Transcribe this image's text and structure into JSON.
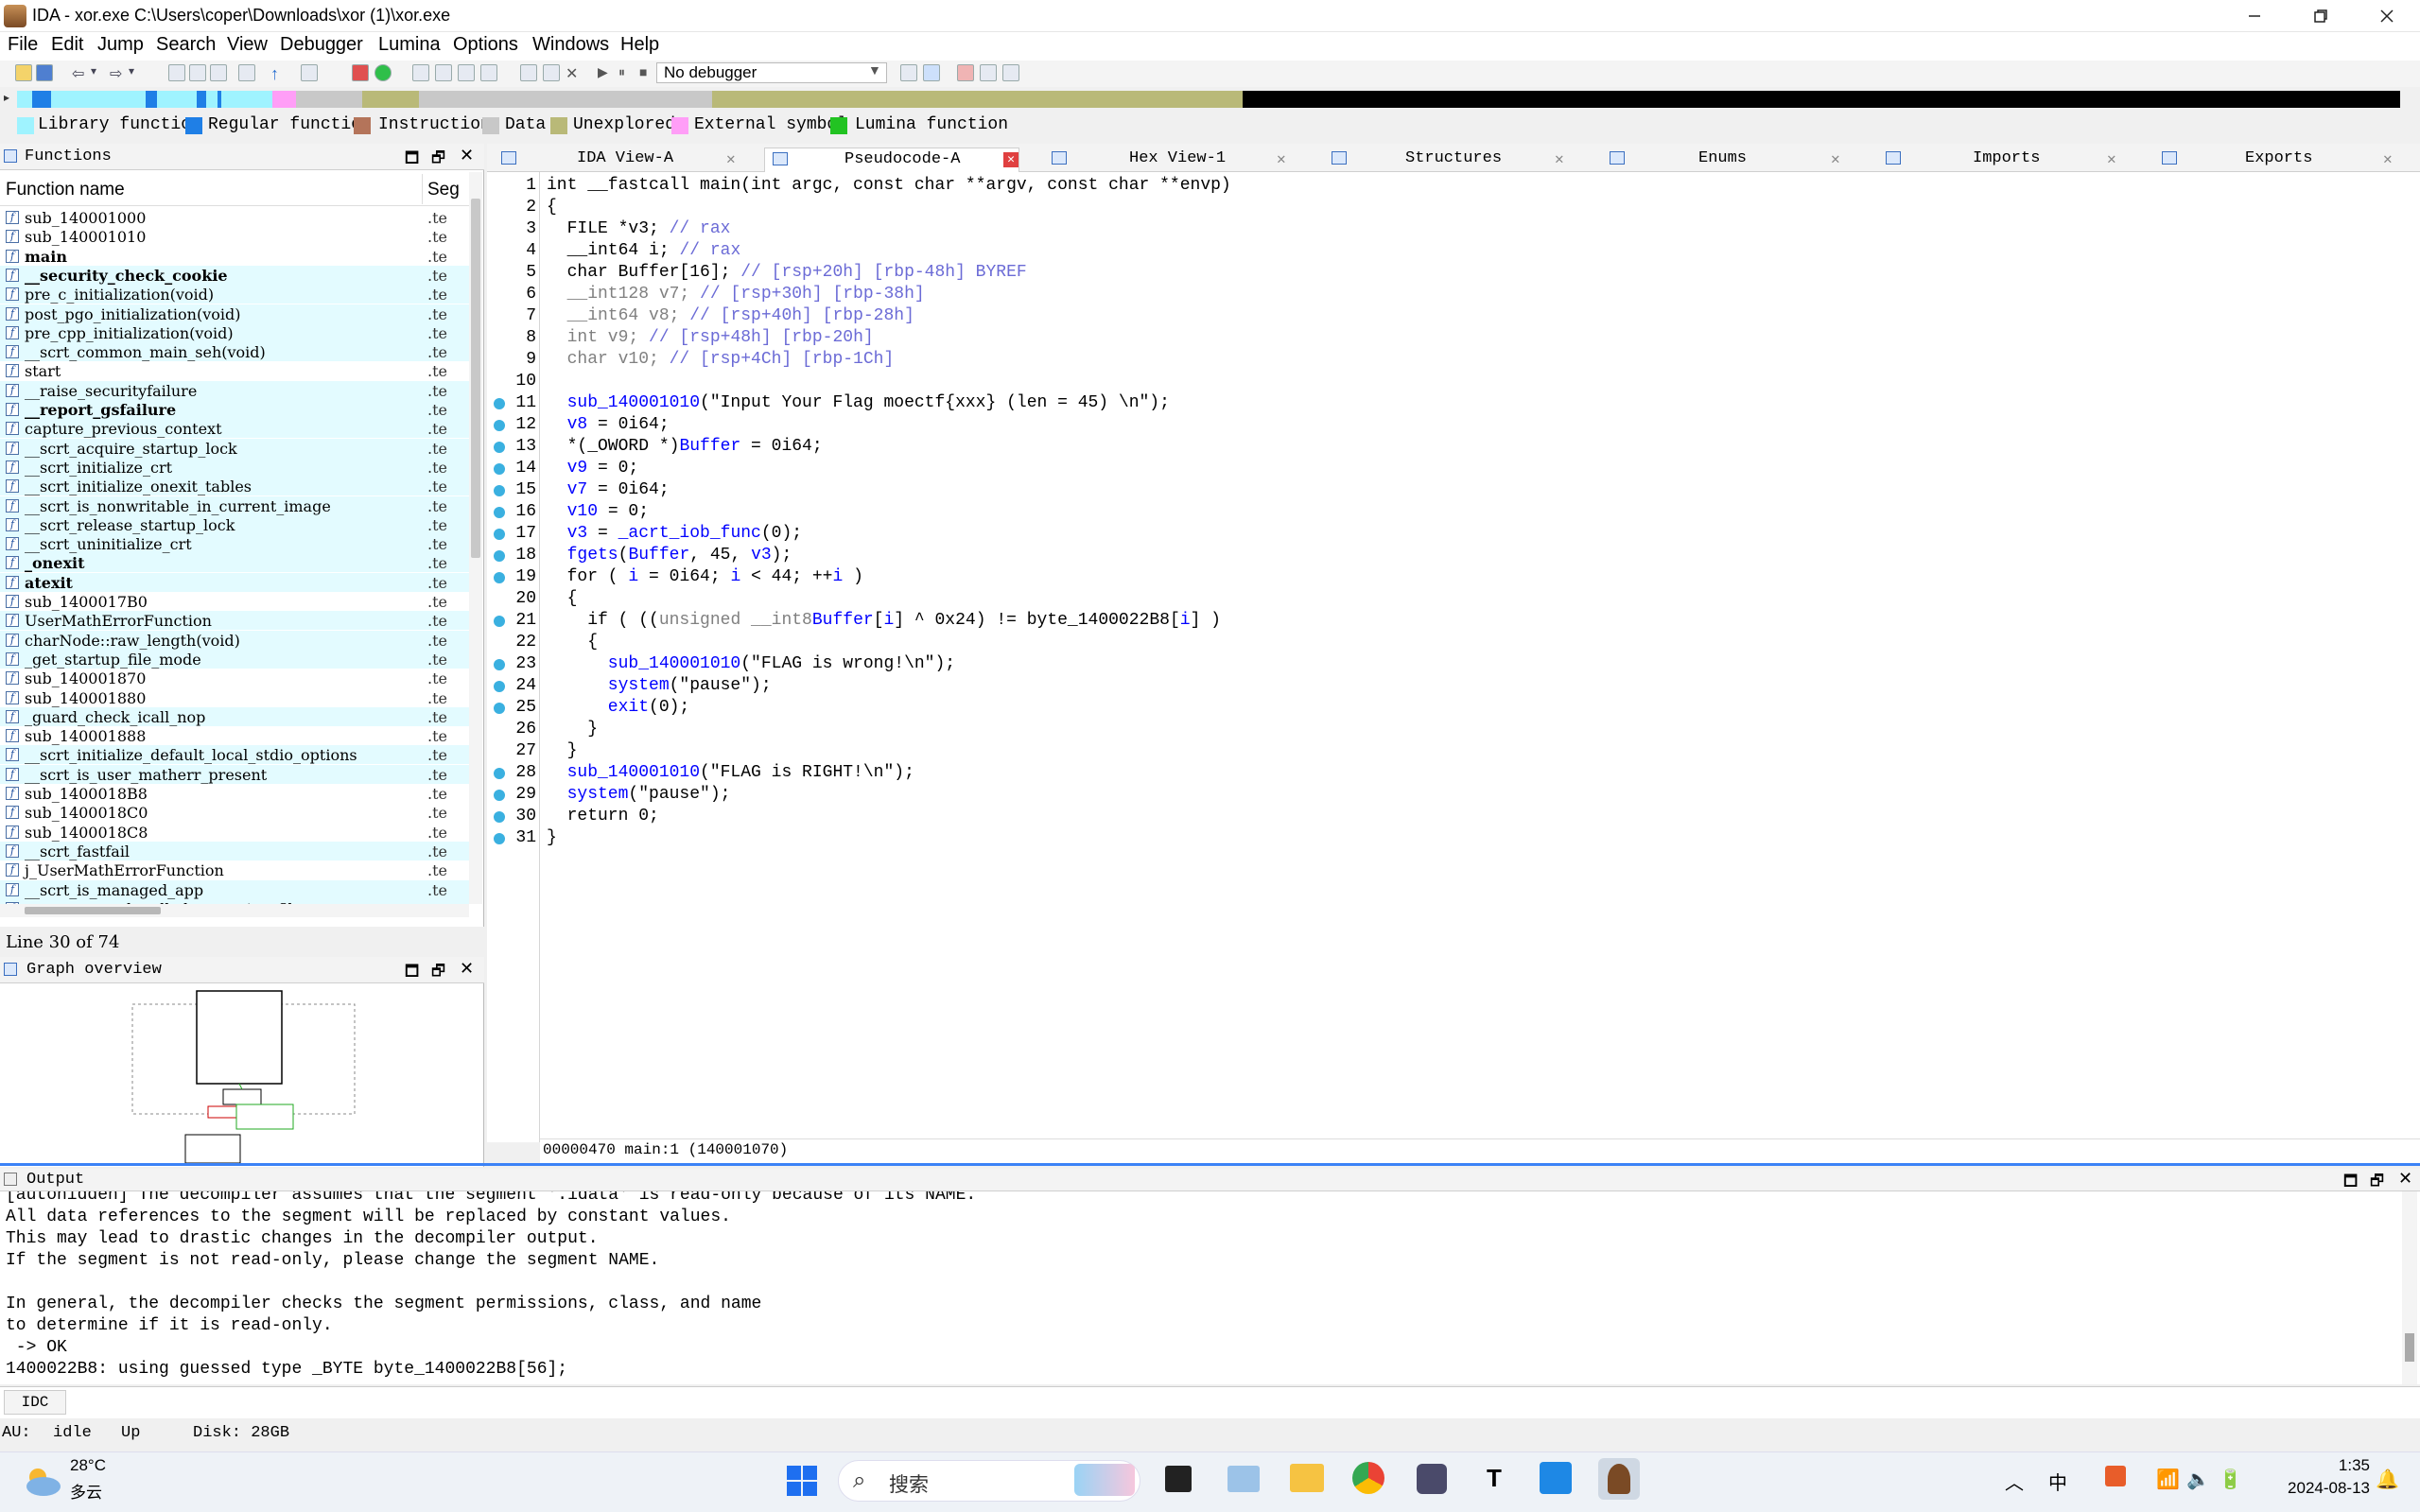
{
  "window": {
    "title": "IDA - xor.exe C:\\Users\\coper\\Downloads\\xor (1)\\xor.exe"
  },
  "menu": [
    "File",
    "Edit",
    "Jump",
    "Search",
    "View",
    "Debugger",
    "Lumina",
    "Options",
    "Windows",
    "Help"
  ],
  "toolbar": {
    "debugger": "No debugger"
  },
  "legend": [
    {
      "label": "Library function",
      "color": "#9ff3ff"
    },
    {
      "label": "Regular function",
      "color": "#1f7fe6"
    },
    {
      "label": "Instruction",
      "color": "#b4745a"
    },
    {
      "label": "Data",
      "color": "#c8c8c8"
    },
    {
      "label": "Unexplored",
      "color": "#b9b978"
    },
    {
      "label": "External symbol",
      "color": "#ff9ef7"
    },
    {
      "label": "Lumina function",
      "color": "#22c322"
    }
  ],
  "functions": {
    "title": "Functions",
    "col_name": "Function name",
    "col_seg": "Seg",
    "items": [
      {
        "name": "sub_140001000",
        "seg": ".te",
        "bold": false,
        "hl": false
      },
      {
        "name": "sub_140001010",
        "seg": ".te",
        "bold": false,
        "hl": false
      },
      {
        "name": "main",
        "seg": ".te",
        "bold": true,
        "hl": false
      },
      {
        "name": "__security_check_cookie",
        "seg": ".te",
        "bold": true,
        "hl": true
      },
      {
        "name": "pre_c_initialization(void)",
        "seg": ".te",
        "bold": false,
        "hl": true
      },
      {
        "name": "post_pgo_initialization(void)",
        "seg": ".te",
        "bold": false,
        "hl": true
      },
      {
        "name": "pre_cpp_initialization(void)",
        "seg": ".te",
        "bold": false,
        "hl": true
      },
      {
        "name": "__scrt_common_main_seh(void)",
        "seg": ".te",
        "bold": false,
        "hl": true
      },
      {
        "name": "start",
        "seg": ".te",
        "bold": false,
        "hl": false
      },
      {
        "name": "__raise_securityfailure",
        "seg": ".te",
        "bold": false,
        "hl": true
      },
      {
        "name": "__report_gsfailure",
        "seg": ".te",
        "bold": true,
        "hl": true
      },
      {
        "name": "capture_previous_context",
        "seg": ".te",
        "bold": false,
        "hl": true
      },
      {
        "name": "__scrt_acquire_startup_lock",
        "seg": ".te",
        "bold": false,
        "hl": true
      },
      {
        "name": "__scrt_initialize_crt",
        "seg": ".te",
        "bold": false,
        "hl": true
      },
      {
        "name": "__scrt_initialize_onexit_tables",
        "seg": ".te",
        "bold": false,
        "hl": true
      },
      {
        "name": "__scrt_is_nonwritable_in_current_image",
        "seg": ".te",
        "bold": false,
        "hl": true
      },
      {
        "name": "__scrt_release_startup_lock",
        "seg": ".te",
        "bold": false,
        "hl": true
      },
      {
        "name": "__scrt_uninitialize_crt",
        "seg": ".te",
        "bold": false,
        "hl": true
      },
      {
        "name": "_onexit",
        "seg": ".te",
        "bold": true,
        "hl": true
      },
      {
        "name": "atexit",
        "seg": ".te",
        "bold": true,
        "hl": true
      },
      {
        "name": "sub_1400017B0",
        "seg": ".te",
        "bold": false,
        "hl": false
      },
      {
        "name": "UserMathErrorFunction",
        "seg": ".te",
        "bold": false,
        "hl": true
      },
      {
        "name": "charNode::raw_length(void)",
        "seg": ".te",
        "bold": false,
        "hl": true
      },
      {
        "name": "_get_startup_file_mode",
        "seg": ".te",
        "bold": false,
        "hl": true
      },
      {
        "name": "sub_140001870",
        "seg": ".te",
        "bold": false,
        "hl": false
      },
      {
        "name": "sub_140001880",
        "seg": ".te",
        "bold": false,
        "hl": false
      },
      {
        "name": "_guard_check_icall_nop",
        "seg": ".te",
        "bold": false,
        "hl": true
      },
      {
        "name": "sub_140001888",
        "seg": ".te",
        "bold": false,
        "hl": false
      },
      {
        "name": "__scrt_initialize_default_local_stdio_options",
        "seg": ".te",
        "bold": false,
        "hl": true
      },
      {
        "name": "__scrt_is_user_matherr_present",
        "seg": ".te",
        "bold": false,
        "hl": true
      },
      {
        "name": "sub_1400018B8",
        "seg": ".te",
        "bold": false,
        "hl": false
      },
      {
        "name": "sub_1400018C0",
        "seg": ".te",
        "bold": false,
        "hl": false
      },
      {
        "name": "sub_1400018C8",
        "seg": ".te",
        "bold": false,
        "hl": false
      },
      {
        "name": "__scrt_fastfail",
        "seg": ".te",
        "bold": false,
        "hl": true
      },
      {
        "name": "j_UserMathErrorFunction",
        "seg": ".te",
        "bold": false,
        "hl": false
      },
      {
        "name": "__scrt_is_managed_app",
        "seg": ".te",
        "bold": false,
        "hl": true
      },
      {
        "name": "__scrt_set_unhandled_exception_filter",
        "seg": ".te",
        "bold": false,
        "hl": true
      }
    ],
    "status": "Line 30 of 74"
  },
  "graph": {
    "title": "Graph overview"
  },
  "tabs": [
    {
      "label": "IDA View-A",
      "active": false
    },
    {
      "label": "Pseudocode-A",
      "active": true
    },
    {
      "label": "Hex View-1",
      "active": false
    },
    {
      "label": "Structures",
      "active": false
    },
    {
      "label": "Enums",
      "active": false
    },
    {
      "label": "Imports",
      "active": false
    },
    {
      "label": "Exports",
      "active": false
    }
  ],
  "code": {
    "lines": [
      {
        "n": "1",
        "bp": false,
        "s": [
          [
            "",
            "int __fastcall main(int argc, const char **argv, const char **envp)"
          ]
        ]
      },
      {
        "n": "2",
        "bp": false,
        "s": [
          [
            "",
            "{"
          ]
        ]
      },
      {
        "n": "3",
        "bp": false,
        "s": [
          [
            "",
            "  FILE *v3; "
          ],
          [
            "cmt",
            "// rax"
          ]
        ]
      },
      {
        "n": "4",
        "bp": false,
        "s": [
          [
            "",
            "  __int64 i; "
          ],
          [
            "cmt",
            "// rax"
          ]
        ]
      },
      {
        "n": "5",
        "bp": false,
        "s": [
          [
            "",
            "  char Buffer[16]; "
          ],
          [
            "cmt",
            "// [rsp+20h] [rbp-48h] BYREF"
          ]
        ]
      },
      {
        "n": "6",
        "bp": false,
        "s": [
          [
            "gray",
            "  __int128 v7; "
          ],
          [
            "cmt",
            "// [rsp+30h] [rbp-38h]"
          ]
        ]
      },
      {
        "n": "7",
        "bp": false,
        "s": [
          [
            "gray",
            "  __int64 v8; "
          ],
          [
            "cmt",
            "// [rsp+40h] [rbp-28h]"
          ]
        ]
      },
      {
        "n": "8",
        "bp": false,
        "s": [
          [
            "gray",
            "  int v9; "
          ],
          [
            "cmt",
            "// [rsp+48h] [rbp-20h]"
          ]
        ]
      },
      {
        "n": "9",
        "bp": false,
        "s": [
          [
            "gray",
            "  char v10; "
          ],
          [
            "cmt",
            "// [rsp+4Ch] [rbp-1Ch]"
          ]
        ]
      },
      {
        "n": "10",
        "bp": false,
        "s": [
          [
            "",
            ""
          ]
        ]
      },
      {
        "n": "11",
        "bp": true,
        "s": [
          [
            "blue",
            "  sub_140001010"
          ],
          [
            "",
            "(\"Input Your Flag moectf{xxx} (len = 45) \\n\");"
          ]
        ]
      },
      {
        "n": "12",
        "bp": true,
        "s": [
          [
            "blue",
            "  v8"
          ],
          [
            "",
            " = 0i64;"
          ]
        ]
      },
      {
        "n": "13",
        "bp": true,
        "s": [
          [
            "",
            "  *(_OWORD *)"
          ],
          [
            "blue",
            "Buffer"
          ],
          [
            "",
            " = 0i64;"
          ]
        ]
      },
      {
        "n": "14",
        "bp": true,
        "s": [
          [
            "blue",
            "  v9"
          ],
          [
            "",
            " = 0;"
          ]
        ]
      },
      {
        "n": "15",
        "bp": true,
        "s": [
          [
            "blue",
            "  v7"
          ],
          [
            "",
            " = 0i64;"
          ]
        ]
      },
      {
        "n": "16",
        "bp": true,
        "s": [
          [
            "blue",
            "  v10"
          ],
          [
            "",
            " = 0;"
          ]
        ]
      },
      {
        "n": "17",
        "bp": true,
        "s": [
          [
            "blue",
            "  v3"
          ],
          [
            "",
            " = "
          ],
          [
            "blue",
            "_acrt_iob_func"
          ],
          [
            "",
            "(0);"
          ]
        ]
      },
      {
        "n": "18",
        "bp": true,
        "s": [
          [
            "blue",
            "  fgets"
          ],
          [
            "",
            "("
          ],
          [
            "blue",
            "Buffer"
          ],
          [
            "",
            ", 45, "
          ],
          [
            "blue",
            "v3"
          ],
          [
            "",
            ");"
          ]
        ]
      },
      {
        "n": "19",
        "bp": true,
        "s": [
          [
            "",
            "  for ( "
          ],
          [
            "blue",
            "i"
          ],
          [
            "",
            " = 0i64; "
          ],
          [
            "blue",
            "i"
          ],
          [
            "",
            " < 44; ++"
          ],
          [
            "blue",
            "i"
          ],
          [
            "",
            " )"
          ]
        ]
      },
      {
        "n": "20",
        "bp": false,
        "s": [
          [
            "",
            "  {"
          ]
        ]
      },
      {
        "n": "21",
        "bp": true,
        "s": [
          [
            "",
            "    if ( (("
          ],
          [
            "gray",
            "unsigned __int8"
          ],
          [
            ")"
          ],
          [
            "blue",
            "Buffer"
          ],
          [
            "",
            "["
          ],
          [
            "blue",
            "i"
          ],
          [
            "",
            "] ^ 0x24) != byte_1400022B8["
          ],
          [
            "blue",
            "i"
          ],
          [
            "",
            "] )"
          ]
        ]
      },
      {
        "n": "22",
        "bp": false,
        "s": [
          [
            "",
            "    {"
          ]
        ]
      },
      {
        "n": "23",
        "bp": true,
        "s": [
          [
            "blue",
            "      sub_140001010"
          ],
          [
            "",
            "(\"FLAG is wrong!\\n\");"
          ]
        ]
      },
      {
        "n": "24",
        "bp": true,
        "s": [
          [
            "blue",
            "      system"
          ],
          [
            "",
            "(\"pause\");"
          ]
        ]
      },
      {
        "n": "25",
        "bp": true,
        "s": [
          [
            "blue",
            "      exit"
          ],
          [
            "",
            "(0);"
          ]
        ]
      },
      {
        "n": "26",
        "bp": false,
        "s": [
          [
            "",
            "    }"
          ]
        ]
      },
      {
        "n": "27",
        "bp": false,
        "s": [
          [
            "",
            "  }"
          ]
        ]
      },
      {
        "n": "28",
        "bp": true,
        "s": [
          [
            "blue",
            "  sub_140001010"
          ],
          [
            "",
            "(\"FLAG is RIGHT!\\n\");"
          ]
        ]
      },
      {
        "n": "29",
        "bp": true,
        "s": [
          [
            "blue",
            "  system"
          ],
          [
            "",
            "(\"pause\");"
          ]
        ]
      },
      {
        "n": "30",
        "bp": true,
        "s": [
          [
            "",
            "  return 0;"
          ]
        ]
      },
      {
        "n": "31",
        "bp": true,
        "s": [
          [
            "",
            "}"
          ]
        ]
      }
    ],
    "status": "00000470 main:1 (140001070)"
  },
  "output": {
    "title": "Output",
    "lines": [
      "[autohidden] The decompiler assumes that the segment '.idata' is read-only because of its NAME.",
      "All data references to the segment will be replaced by constant values.",
      "This may lead to drastic changes in the decompiler output.",
      "If the segment is not read-only, please change the segment NAME.",
      "",
      "In general, the decompiler checks the segment permissions, class, and name",
      "to determine if it is read-only.",
      " -> OK",
      "1400022B8: using guessed type _BYTE byte_1400022B8[56];"
    ],
    "idc": "IDC"
  },
  "statusbar": {
    "au": "AU:",
    "idle": "idle",
    "up": "Up",
    "disk": "Disk: 28GB"
  },
  "taskbar": {
    "temp": "28°C",
    "weather": "多云",
    "search": "搜索",
    "time": "1:35",
    "date": "2024-08-13",
    "ime": "中"
  }
}
